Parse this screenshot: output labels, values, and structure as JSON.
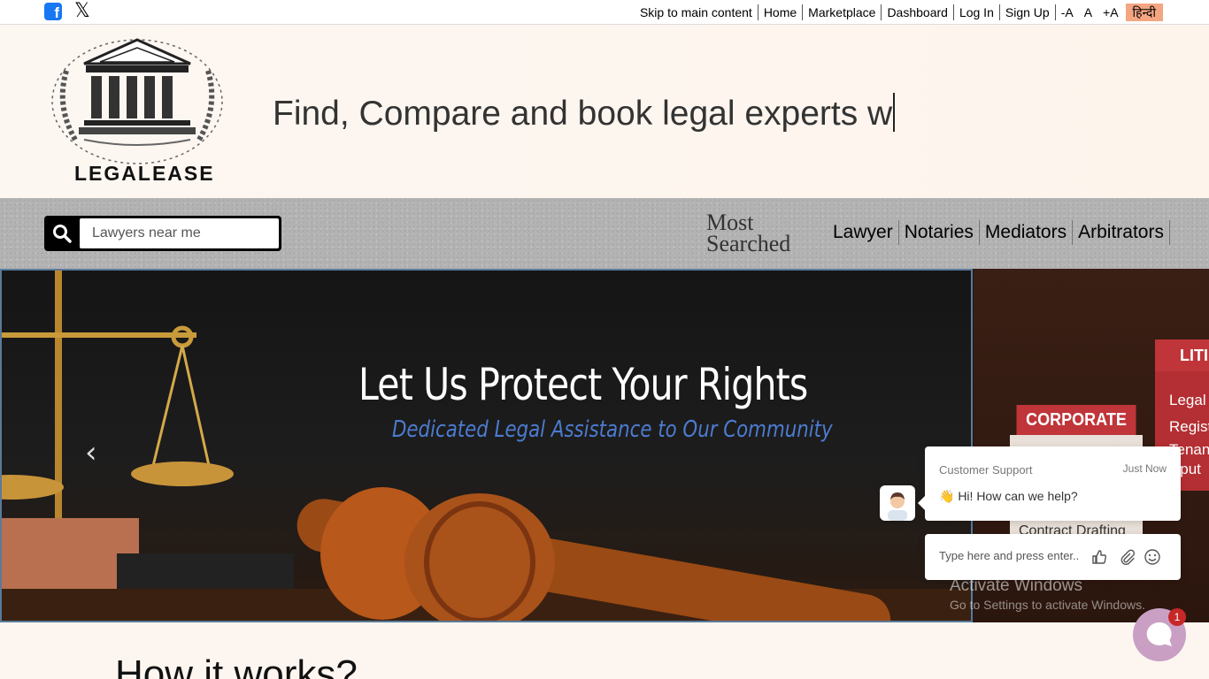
{
  "topbar": {
    "social": [
      "facebook-icon",
      "x-icon"
    ],
    "links": [
      "Skip to main content",
      "Home",
      "Marketplace",
      "Dashboard",
      "Log In",
      "Sign Up"
    ],
    "font_sizes": [
      "-A",
      "A",
      "+A"
    ],
    "language": "हिन्दी"
  },
  "header": {
    "logo_text": "LEGALEASE",
    "tagline": "Find, Compare and book legal experts w"
  },
  "search": {
    "placeholder": "Lawyers near me",
    "icon": "search-icon"
  },
  "most_searched": {
    "label_line1": "Most",
    "label_line2": "Searched",
    "items": [
      "Lawyer",
      "Notaries",
      "Mediators",
      "Arbitrators"
    ]
  },
  "carousel": {
    "title": "Let Us Protect Your Rights",
    "subtitle": "Dedicated Legal Assistance to Our Community",
    "side_badge": "CORPORATE LAW",
    "side_item": "Contract Drafting",
    "side_badge2": "LITI",
    "side_items2": [
      "Legal N",
      "Regist",
      "Tenanc",
      "isput"
    ]
  },
  "watermark": {
    "line1": "Activate Windows",
    "line2": "Go to Settings to activate Windows."
  },
  "section": {
    "how_title": "How it works?"
  },
  "chat": {
    "name": "Customer Support",
    "time": "Just Now",
    "message": "👋 Hi! How can we help?",
    "input_placeholder": "Type here and press enter..",
    "badge_count": "1"
  },
  "colors": {
    "hindi_bg": "#f4a582",
    "facebook": "#1877f2",
    "badge_red": "#c0353a",
    "launcher": "#c9a0c4"
  }
}
